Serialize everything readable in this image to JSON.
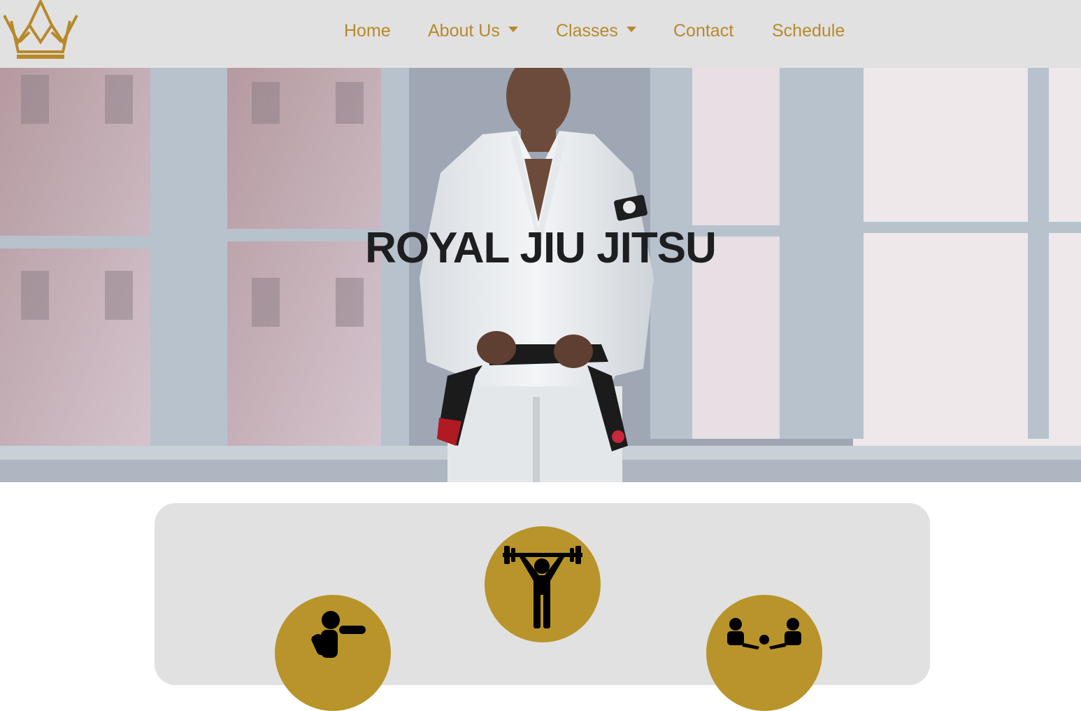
{
  "nav": {
    "items": [
      {
        "label": "Home",
        "has_dropdown": false
      },
      {
        "label": "About Us",
        "has_dropdown": true
      },
      {
        "label": "Classes",
        "has_dropdown": true
      },
      {
        "label": "Contact",
        "has_dropdown": false
      },
      {
        "label": "Schedule",
        "has_dropdown": false
      }
    ]
  },
  "hero": {
    "title": "ROYAL JIU JITSU"
  },
  "icons": {
    "left": "boxing-icon",
    "center": "weightlifting-icon",
    "right": "group-icon"
  },
  "colors": {
    "accent": "#b8892b",
    "icon_circle": "#b8942a",
    "navbar_bg": "#e1e1e1",
    "panel_bg": "#e1e1e1",
    "title": "#1d1e20"
  }
}
